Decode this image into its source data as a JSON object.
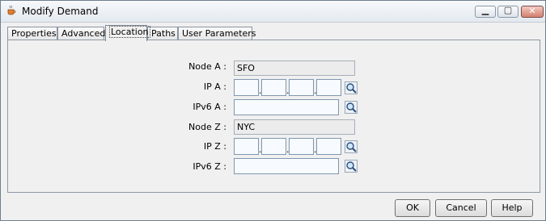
{
  "window": {
    "title": "Modify Demand"
  },
  "tabs": [
    {
      "label": "Properties"
    },
    {
      "label": "Advanced"
    },
    {
      "label": "Location"
    },
    {
      "label": "Paths"
    },
    {
      "label": "User Parameters"
    }
  ],
  "active_tab": "Location",
  "form": {
    "node_a": {
      "label": "Node A :",
      "value": "SFO"
    },
    "ip_a": {
      "label": "IP A :",
      "octets": [
        "",
        "",
        "",
        ""
      ]
    },
    "ipv6_a": {
      "label": "IPv6 A :",
      "value": ""
    },
    "node_z": {
      "label": "Node Z :",
      "value": "NYC"
    },
    "ip_z": {
      "label": "IP Z :",
      "octets": [
        "",
        "",
        "",
        ""
      ]
    },
    "ipv6_z": {
      "label": "IPv6 Z :",
      "value": ""
    },
    "separator": "."
  },
  "buttons": {
    "ok": "OK",
    "cancel": "Cancel",
    "help": "Help"
  },
  "icons": {
    "app": "java-cup-icon",
    "lookup": "magnifier-icon",
    "minimize": "minimize-icon",
    "maximize": "maximize-icon",
    "close": "close-icon"
  }
}
